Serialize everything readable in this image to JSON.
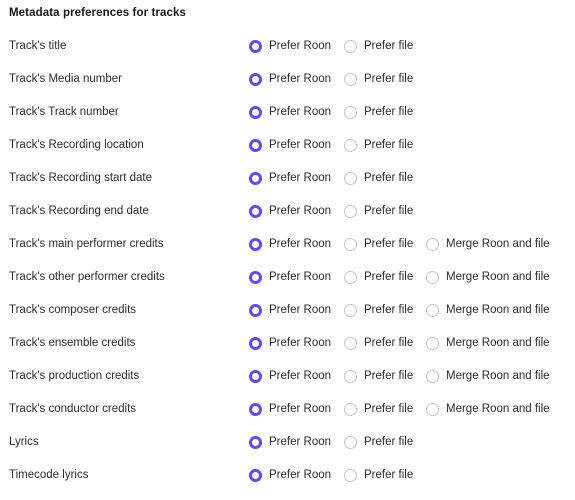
{
  "section": {
    "title": "Metadata preferences for tracks"
  },
  "colors": {
    "accent": "#5d50e0",
    "radio_off_border": "#c3c4c8",
    "text": "#2a2b2f",
    "title_text": "#17181b",
    "background": "#ffffff"
  },
  "options_catalog": {
    "prefer_roon": "Prefer Roon",
    "prefer_file": "Prefer file",
    "merge": "Merge Roon and file"
  },
  "rows": [
    {
      "label": "Track's title",
      "options": [
        {
          "label": "Prefer Roon",
          "selected": true
        },
        {
          "label": "Prefer file",
          "selected": false
        }
      ]
    },
    {
      "label": "Track's Media number",
      "options": [
        {
          "label": "Prefer Roon",
          "selected": true
        },
        {
          "label": "Prefer file",
          "selected": false
        }
      ]
    },
    {
      "label": "Track's Track number",
      "options": [
        {
          "label": "Prefer Roon",
          "selected": true
        },
        {
          "label": "Prefer file",
          "selected": false
        }
      ]
    },
    {
      "label": "Track's Recording location",
      "options": [
        {
          "label": "Prefer Roon",
          "selected": true
        },
        {
          "label": "Prefer file",
          "selected": false
        }
      ]
    },
    {
      "label": "Track's Recording start date",
      "options": [
        {
          "label": "Prefer Roon",
          "selected": true
        },
        {
          "label": "Prefer file",
          "selected": false
        }
      ]
    },
    {
      "label": "Track's Recording end date",
      "options": [
        {
          "label": "Prefer Roon",
          "selected": true
        },
        {
          "label": "Prefer file",
          "selected": false
        }
      ]
    },
    {
      "label": "Track's main performer credits",
      "options": [
        {
          "label": "Prefer Roon",
          "selected": true
        },
        {
          "label": "Prefer file",
          "selected": false
        },
        {
          "label": "Merge Roon and file",
          "selected": false
        }
      ]
    },
    {
      "label": "Track's other performer credits",
      "options": [
        {
          "label": "Prefer Roon",
          "selected": true
        },
        {
          "label": "Prefer file",
          "selected": false
        },
        {
          "label": "Merge Roon and file",
          "selected": false
        }
      ]
    },
    {
      "label": "Track's composer credits",
      "options": [
        {
          "label": "Prefer Roon",
          "selected": true
        },
        {
          "label": "Prefer file",
          "selected": false
        },
        {
          "label": "Merge Roon and file",
          "selected": false
        }
      ]
    },
    {
      "label": "Track's ensemble credits",
      "options": [
        {
          "label": "Prefer Roon",
          "selected": true
        },
        {
          "label": "Prefer file",
          "selected": false
        },
        {
          "label": "Merge Roon and file",
          "selected": false
        }
      ]
    },
    {
      "label": "Track's production credits",
      "options": [
        {
          "label": "Prefer Roon",
          "selected": true
        },
        {
          "label": "Prefer file",
          "selected": false
        },
        {
          "label": "Merge Roon and file",
          "selected": false
        }
      ]
    },
    {
      "label": "Track's conductor credits",
      "options": [
        {
          "label": "Prefer Roon",
          "selected": true
        },
        {
          "label": "Prefer file",
          "selected": false
        },
        {
          "label": "Merge Roon and file",
          "selected": false
        }
      ]
    },
    {
      "label": "Lyrics",
      "options": [
        {
          "label": "Prefer Roon",
          "selected": true
        },
        {
          "label": "Prefer file",
          "selected": false
        }
      ]
    },
    {
      "label": "Timecode lyrics",
      "options": [
        {
          "label": "Prefer Roon",
          "selected": true
        },
        {
          "label": "Prefer file",
          "selected": false
        }
      ]
    }
  ]
}
